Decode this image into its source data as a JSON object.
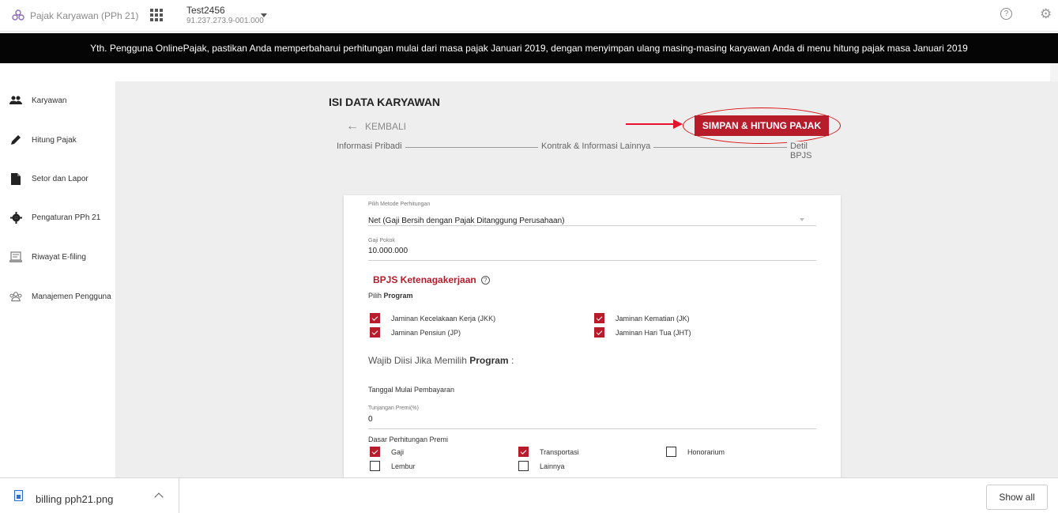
{
  "header": {
    "app_title": "Pajak Karyawan (PPh 21)",
    "company_name": "Test2456",
    "company_npwp": "91.237.273.9-001.000",
    "help_symbol": "?",
    "settings_symbol": "⚙"
  },
  "announcement": "Yth. Pengguna OnlinePajak, pastikan Anda memperbaharui perhitungan mulai dari masa pajak Januari 2019, dengan menyimpan ulang masing-masing karyawan Anda di menu hitung pajak masa Januari 2019",
  "sidebar": {
    "items": [
      {
        "label": "Karyawan",
        "icon": "people-icon"
      },
      {
        "label": "Hitung Pajak",
        "icon": "pencil-icon"
      },
      {
        "label": "Setor dan Lapor",
        "icon": "document-icon"
      },
      {
        "label": "Pengaturan PPh 21",
        "icon": "gear-icon"
      },
      {
        "label": "Riwayat E-filing",
        "icon": "history-icon"
      },
      {
        "label": "Manajemen Pengguna",
        "icon": "users-manage-icon"
      }
    ]
  },
  "main": {
    "title": "ISI DATA KARYAWAN",
    "back_label": "KEMBALI",
    "back_arrow": "←",
    "save_button": "SIMPAN & HITUNG PAJAK",
    "steps": [
      "Informasi Pribadi",
      "Kontrak & Informasi Lainnya",
      "Detil BPJS"
    ]
  },
  "form": {
    "metode_label": "Pilih Metode Perhitungan",
    "metode_value": "Net (Gaji Bersih dengan Pajak Ditanggung Perusahaan)",
    "gaji_label": "Gaji Pokok",
    "gaji_value": "10.000.000",
    "bpjs_title": "BPJS Ketenagakerjaan",
    "info_symbol": "?",
    "pilih_prefix": "Pilih",
    "pilih_bold": "Program",
    "programs": [
      {
        "label": "Jaminan Kecelakaan Kerja (JKK)",
        "checked": true
      },
      {
        "label": "Jaminan Kematian (JK)",
        "checked": true
      },
      {
        "label": "Jaminan Pensiun (JP)",
        "checked": true
      },
      {
        "label": "Jaminan Hari Tua (JHT)",
        "checked": true
      }
    ],
    "wajib_prefix": "Wajib Diisi Jika Memilih",
    "wajib_bold": "Program",
    "wajib_suffix": ":",
    "tanggal_label": "Tanggal Mulai Pembayaran",
    "tunjangan_label": "Tunjangan Premi(%)",
    "tunjangan_value": "0",
    "dasar_label": "Dasar Perhitungan Premi",
    "dasar_options": [
      {
        "label": "Gaji",
        "checked": true
      },
      {
        "label": "Transportasi",
        "checked": true
      },
      {
        "label": "Honorarium",
        "checked": false
      },
      {
        "label": "Lembur",
        "checked": false
      },
      {
        "label": "Lainnya",
        "checked": false
      }
    ]
  },
  "download_bar": {
    "file_name": "billing pph21.png",
    "show_all": "Show all"
  }
}
